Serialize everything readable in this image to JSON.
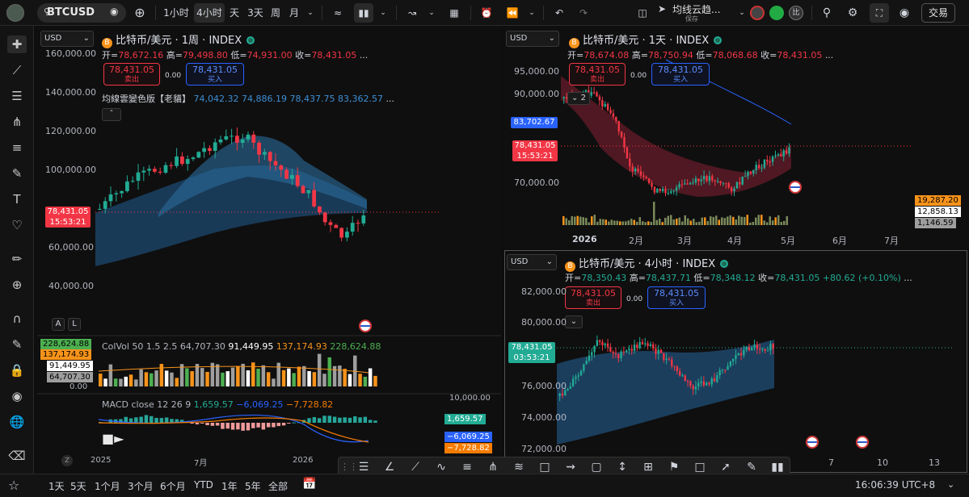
{
  "topbar": {
    "symbol": "BTCUSD",
    "intervals": [
      "1小时",
      "4小时",
      "天",
      "3天",
      "周",
      "月"
    ],
    "active_interval": "4小时",
    "indicator_name": "均线云趋...",
    "indicator_sub": "保存",
    "trade": "交易",
    "avatar_badge": "比"
  },
  "bottombar": {
    "ranges": [
      "1天",
      "5天",
      "1个月",
      "3个月",
      "6个月",
      "YTD",
      "1年",
      "5年",
      "全部"
    ],
    "clock": "16:06:39 UTC+8"
  },
  "colors": {
    "up": "#22ab94",
    "down": "#f23645",
    "blue": "#2962ff",
    "cloud": "#1e5a8a",
    "cloud_red": "#7a2030"
  },
  "chart1": {
    "currency": "USD",
    "title": "比特币/美元 · 1周 · INDEX",
    "ohlc": {
      "o_label": "开=",
      "o": "78,672.16",
      "h_label": "高=",
      "h": "79,498.80",
      "l_label": "低=",
      "l": "74,931.00",
      "c_label": "收=",
      "c": "78,431.05",
      "more": "..."
    },
    "sell": {
      "price": "78,431.05",
      "label": "卖出"
    },
    "spread": "0.00",
    "buy": {
      "price": "78,431.05",
      "label": "买入"
    },
    "indicator": {
      "name": "均線雲變色版【老貓】",
      "v1": "74,042.32",
      "v2": "74,886.19",
      "v3": "78,437.75",
      "v4": "83,362.57",
      "more": "..."
    },
    "y_ticks": [
      "160,000.00",
      "140,000.00",
      "120,000.00",
      "100,000.00",
      "60,000.00",
      "40,000.00"
    ],
    "price_tag": {
      "price": "78,431.05",
      "time": "15:53:21"
    },
    "x_ticks": [
      "2025",
      "7月",
      "2026"
    ],
    "btn_a": "A",
    "btn_l": "L",
    "colvol": {
      "label": "ColVol 50 1.5 2.5",
      "v1": "64,707.30",
      "v2": "91,449.95",
      "v3": "137,174.93",
      "v4": "228,624.88"
    },
    "colvol_axis": [
      "228,624.88",
      "137,174.93",
      "91,449.95",
      "64,707.30",
      "0.00"
    ],
    "macd": {
      "label": "MACD close 12 26 9",
      "v1": "1,659.57",
      "v2": "−6,069.25",
      "v3": "−7,728.82"
    },
    "macd_axis": {
      "top": "10,000.00",
      "v1": "1,659.57",
      "v2": "−6,069.25",
      "v3": "−7,728.82"
    }
  },
  "chart2": {
    "currency": "USD",
    "title": "比特币/美元 · 1天 · INDEX",
    "ohlc": {
      "o_label": "开=",
      "o": "78,674.08",
      "h_label": "高=",
      "h": "78,750.94",
      "l_label": "低=",
      "l": "78,068.68",
      "c_label": "收=",
      "c": "78,431.05",
      "more": "..."
    },
    "sell": {
      "price": "78,431.05",
      "label": "卖出"
    },
    "spread": "0.00",
    "buy": {
      "price": "78,431.05",
      "label": "买入"
    },
    "collapse_count": "2",
    "y_ticks": [
      "95,000.00",
      "90,000.00",
      "70,000.00"
    ],
    "tag_blue": "83,702.67",
    "price_tag": {
      "price": "78,431.05",
      "time": "15:53:21"
    },
    "vol_tags": [
      "19,287.20",
      "12,858.13",
      "1,146.59"
    ],
    "x_ticks": [
      "2026",
      "2月",
      "3月",
      "4月",
      "5月",
      "6月",
      "7月"
    ]
  },
  "chart3": {
    "currency": "USD",
    "title": "比特币/美元 · 4小时 · INDEX",
    "ohlc": {
      "o_label": "开=",
      "o": "78,350.43",
      "h_label": "高=",
      "h": "78,437.71",
      "l_label": "低=",
      "l": "78,348.12",
      "c_label": "收=",
      "c": "78,431.05",
      "change": "+80.62 (+0.10%)",
      "more": "..."
    },
    "sell": {
      "price": "78,431.05",
      "label": "卖出"
    },
    "spread": "0.00",
    "buy": {
      "price": "78,431.05",
      "label": "买入"
    },
    "y_ticks": [
      "82,000.00",
      "80,000.00",
      "76,000.00",
      "74,000.00",
      "72,000.00"
    ],
    "price_tag": {
      "price": "78,431.05",
      "time": "03:53:21"
    },
    "x_ticks": [
      "7",
      "10",
      "13"
    ]
  }
}
